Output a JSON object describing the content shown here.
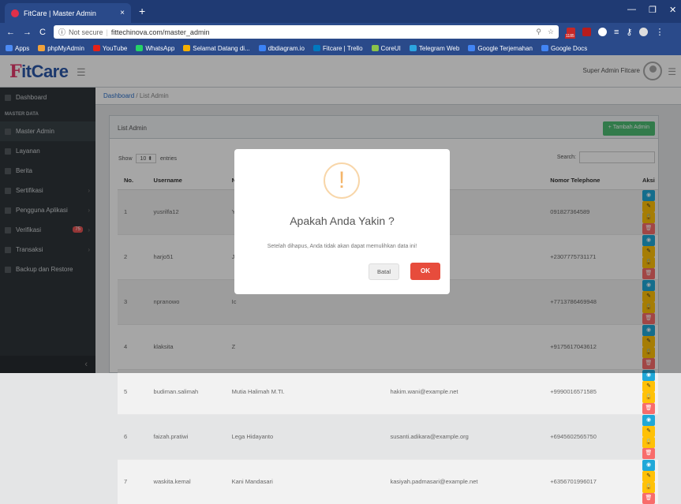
{
  "browser": {
    "tab_title": "FitCare | Master Admin",
    "tab_close": "×",
    "new_tab": "+",
    "not_secure": "Not secure",
    "url": "fittechinova.com/master_admin",
    "ext_badge": "1185",
    "bookmarks": [
      {
        "label": "Apps",
        "color": "#4c8bf5"
      },
      {
        "label": "phpMyAdmin",
        "color": "#f0a23b"
      },
      {
        "label": "YouTube",
        "color": "#e62117"
      },
      {
        "label": "WhatsApp",
        "color": "#25d366"
      },
      {
        "label": "Selamat Datang di...",
        "color": "#f5b000"
      },
      {
        "label": "dbdiagram.io",
        "color": "#3b82f6"
      },
      {
        "label": "Fitcare | Trello",
        "color": "#0079bf"
      },
      {
        "label": "CoreUI",
        "color": "#8bc34a"
      },
      {
        "label": "Telegram Web",
        "color": "#2ca5e0"
      },
      {
        "label": "Google Terjemahan",
        "color": "#4285f4"
      },
      {
        "label": "Google Docs",
        "color": "#4285f4"
      }
    ]
  },
  "header": {
    "logo_prefix": "F",
    "logo_rest": "itCare",
    "admin_label": "Super Admin Fitcare"
  },
  "sidebar": {
    "items_top": [
      {
        "label": "Dashboard"
      }
    ],
    "section_title": "MASTER DATA",
    "items": [
      {
        "label": "Master Admin",
        "active": true
      },
      {
        "label": "Layanan"
      },
      {
        "label": "Berita"
      },
      {
        "label": "Sertifikasi",
        "arrow": "›"
      },
      {
        "label": "Pengguna Aplikasi",
        "arrow": "›"
      },
      {
        "label": "Verifikasi",
        "badge": "75",
        "arrow": "›"
      },
      {
        "label": "Transaksi",
        "arrow": "›"
      },
      {
        "label": "Backup dan Restore"
      }
    ],
    "collapse_icon": "‹"
  },
  "breadcrumb": {
    "home": "Dashboard",
    "sep": "/",
    "current": "List Admin"
  },
  "card": {
    "title": "List Admin",
    "add_button": "+ Tambah Admin",
    "show_label": "Show",
    "show_value": "10",
    "entries_label": "entries",
    "search_label": "Search:"
  },
  "table": {
    "headers": [
      "No.",
      "Username",
      "N",
      "",
      "Nomor Telephone",
      "Aksi"
    ],
    "rows": [
      {
        "no": "1",
        "username": "yusrilfa12",
        "name": "Y",
        "email": "",
        "phone": "091827364589"
      },
      {
        "no": "2",
        "username": "harjo51",
        "name": "Je",
        "email": "",
        "phone": "+2307775731171"
      },
      {
        "no": "3",
        "username": "npranowo",
        "name": "Ic",
        "email": "",
        "phone": "+7713786469948"
      },
      {
        "no": "4",
        "username": "klaksita",
        "name": "Z",
        "email": "",
        "phone": "+9175617043612"
      },
      {
        "no": "5",
        "username": "budiman.salimah",
        "name": "Mutia Halimah M.TI.",
        "email": "hakim.wani@example.net",
        "phone": "+9990016571585"
      },
      {
        "no": "6",
        "username": "faizah.pratiwi",
        "name": "Lega Hidayanto",
        "email": "susanti.adikara@example.org",
        "phone": "+6945602565750"
      },
      {
        "no": "7",
        "username": "waskita.kemal",
        "name": "Kani Mandasari",
        "email": "kasiyah.padmasari@example.net",
        "phone": "+6356701996017"
      }
    ]
  },
  "modal": {
    "icon": "!",
    "title": "Apakah Anda Yakin ?",
    "text": "Setelah dihapus, Anda tidak akan dapat memulihkan data ini!",
    "cancel": "Batal",
    "confirm": "OK"
  }
}
